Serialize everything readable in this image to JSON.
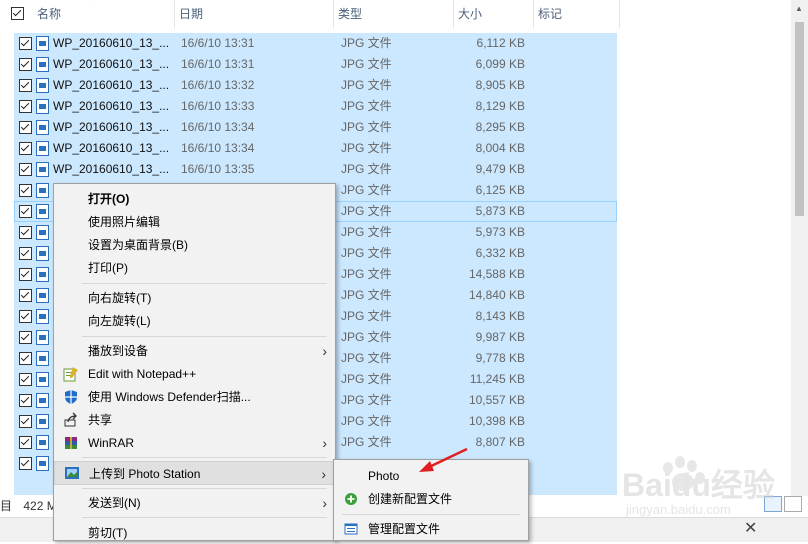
{
  "header": {
    "name": "名称",
    "date": "日期",
    "type": "类型",
    "size": "大小",
    "tags": "标记"
  },
  "files": [
    {
      "name": "WP_20160610_13_...",
      "date": "16/6/10 13:31",
      "type": "JPG 文件",
      "size": "6,112 KB"
    },
    {
      "name": "WP_20160610_13_...",
      "date": "16/6/10 13:31",
      "type": "JPG 文件",
      "size": "6,099 KB"
    },
    {
      "name": "WP_20160610_13_...",
      "date": "16/6/10 13:32",
      "type": "JPG 文件",
      "size": "8,905 KB"
    },
    {
      "name": "WP_20160610_13_...",
      "date": "16/6/10 13:33",
      "type": "JPG 文件",
      "size": "8,129 KB"
    },
    {
      "name": "WP_20160610_13_...",
      "date": "16/6/10 13:34",
      "type": "JPG 文件",
      "size": "8,295 KB"
    },
    {
      "name": "WP_20160610_13_...",
      "date": "16/6/10 13:34",
      "type": "JPG 文件",
      "size": "8,004 KB"
    },
    {
      "name": "WP_20160610_13_...",
      "date": "16/6/10 13:35",
      "type": "JPG 文件",
      "size": "9,479 KB"
    },
    {
      "name": "",
      "date": "",
      "type": "JPG 文件",
      "size": "6,125 KB"
    },
    {
      "name": "",
      "date": "",
      "type": "JPG 文件",
      "size": "5,873 KB"
    },
    {
      "name": "",
      "date": "",
      "type": "JPG 文件",
      "size": "5,973 KB"
    },
    {
      "name": "",
      "date": "",
      "type": "JPG 文件",
      "size": "6,332 KB"
    },
    {
      "name": "",
      "date": "",
      "type": "JPG 文件",
      "size": "14,588 KB"
    },
    {
      "name": "",
      "date": "",
      "type": "JPG 文件",
      "size": "14,840 KB"
    },
    {
      "name": "",
      "date": "",
      "type": "JPG 文件",
      "size": "8,143 KB"
    },
    {
      "name": "",
      "date": "",
      "type": "JPG 文件",
      "size": "9,987 KB"
    },
    {
      "name": "",
      "date": "",
      "type": "JPG 文件",
      "size": "9,778 KB"
    },
    {
      "name": "",
      "date": "",
      "type": "JPG 文件",
      "size": "11,245 KB"
    },
    {
      "name": "",
      "date": "",
      "type": "JPG 文件",
      "size": "10,557 KB"
    },
    {
      "name": "",
      "date": "",
      "type": "JPG 文件",
      "size": "10,398 KB"
    },
    {
      "name": "",
      "date": "",
      "type": "JPG 文件",
      "size": "8,807 KB"
    },
    {
      "name": "",
      "date": "",
      "type": "",
      "size": ""
    },
    {
      "name": "",
      "date": "",
      "type": "",
      "size": ""
    }
  ],
  "status": {
    "left": "目",
    "count": "422 M"
  },
  "context_menu": {
    "open": "打开(O)",
    "edit_photos": "使用照片编辑",
    "set_desktop": "设置为桌面背景(B)",
    "print": "打印(P)",
    "rotate_right": "向右旋转(T)",
    "rotate_left": "向左旋转(L)",
    "cast": "播放到设备",
    "notepad": "Edit with Notepad++",
    "defender": "使用 Windows Defender扫描...",
    "share": "共享",
    "winrar": "WinRAR",
    "photo_station": "上传到 Photo Station",
    "send_to": "发送到(N)",
    "cut": "剪切(T)"
  },
  "submenu": {
    "photo": "Photo",
    "create_profile": "创建新配置文件",
    "manage_profile": "管理配置文件"
  },
  "watermark": {
    "brand": "Baidu经验",
    "url": "jingyan.baidu.com"
  },
  "colors": {
    "selection": "#cce8ff",
    "menu_bg": "#f2f2f2",
    "annotation_arrow": "#e02020"
  }
}
